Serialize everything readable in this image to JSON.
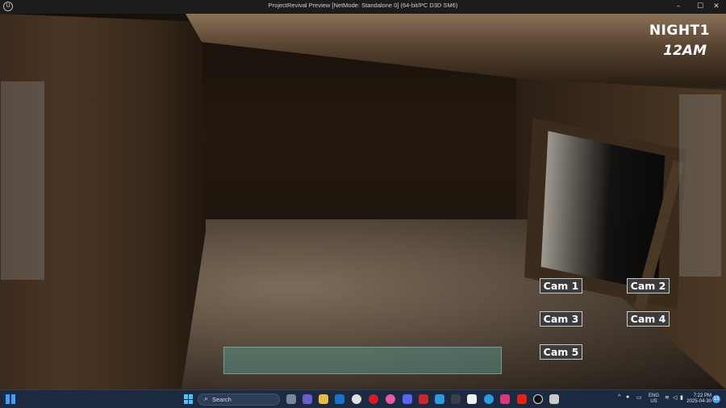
{
  "window": {
    "title": "ProjectRevival Preview [NetMode: Standalone 0]  (64-bit/PC D3D SM6)",
    "app_icon": "unreal-engine-icon",
    "controls": [
      "minimize",
      "maximize",
      "close"
    ]
  },
  "hud": {
    "night": "NIGHT1",
    "time": "12AM"
  },
  "cameras": [
    {
      "label": "Cam 1"
    },
    {
      "label": "Cam 2"
    },
    {
      "label": "Cam 3"
    },
    {
      "label": "Cam 4"
    },
    {
      "label": "Cam 5"
    }
  ],
  "taskbar": {
    "search_placeholder": "Search",
    "apps": [
      "file-explorer-icon",
      "teams-icon",
      "folder-icon",
      "outlook-icon",
      "chrome-icon",
      "opera-icon",
      "itunes-icon",
      "discord-icon",
      "app-red-icon",
      "photos-icon",
      "terminal-icon",
      "notion-icon",
      "edge-icon",
      "app-pink-icon",
      "youtube-icon",
      "unreal-engine-icon",
      "app-bolt-icon"
    ],
    "language": "ENG",
    "region": "US",
    "time": "7:22 PM",
    "date": "2025-04-30",
    "notifications": "13"
  }
}
